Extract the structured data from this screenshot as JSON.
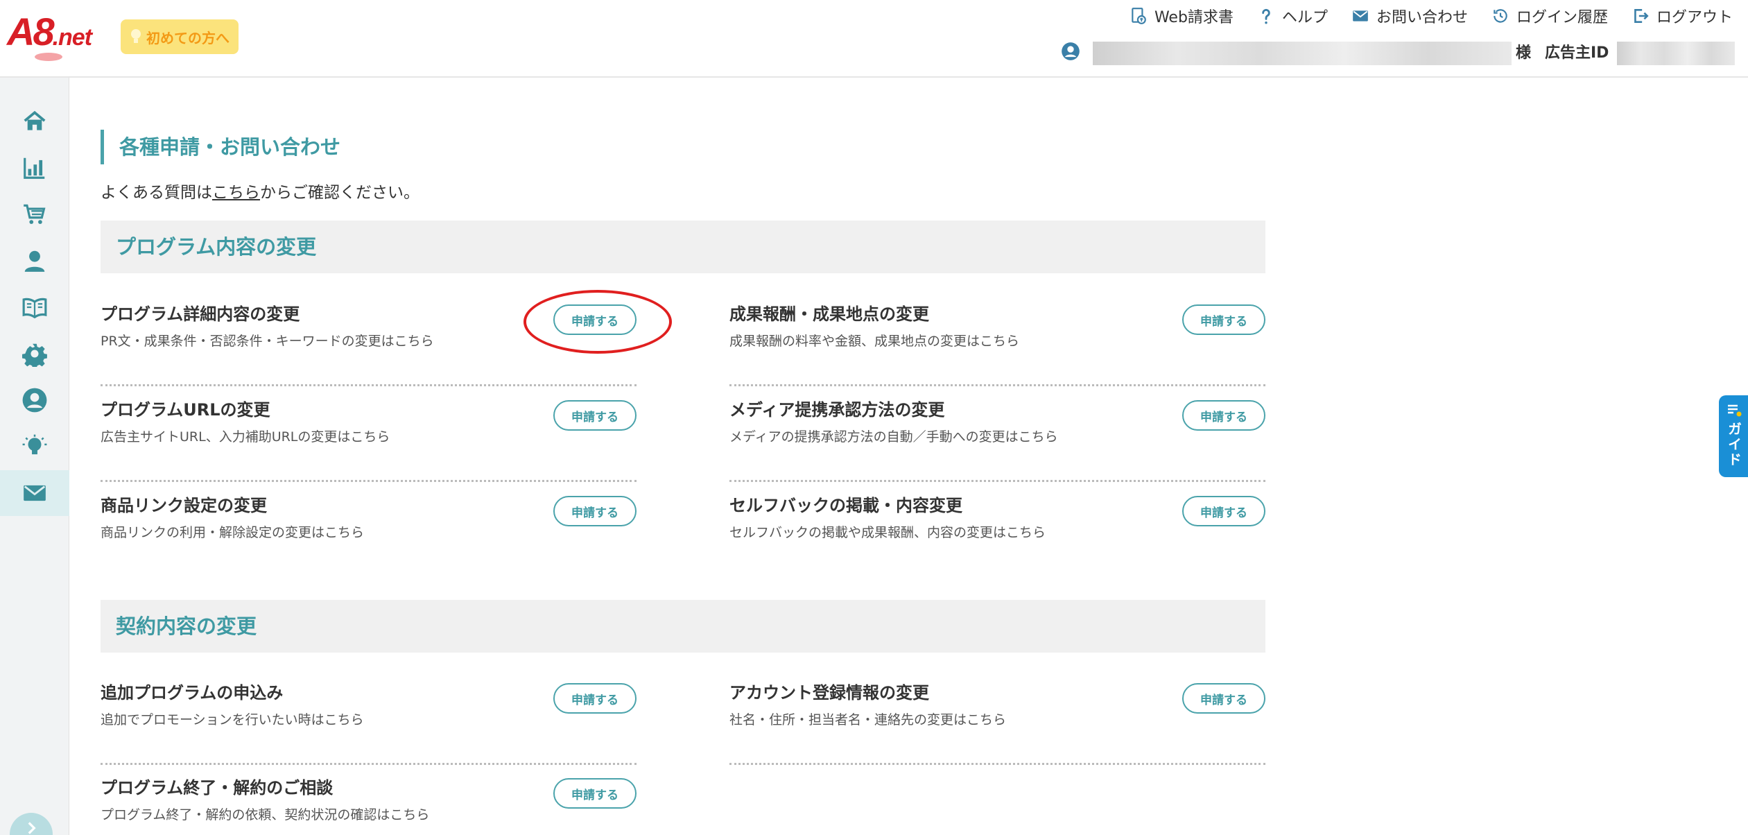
{
  "brand": {
    "logo_main": "A8",
    "logo_suffix": ".net"
  },
  "header": {
    "first_time_label": "初めての方へ",
    "links": {
      "invoice": "Web請求書",
      "help": "ヘルプ",
      "contact": "お問い合わせ",
      "login_history": "ログイン履歴",
      "logout": "ログアウト"
    },
    "account": {
      "name_suffix": "様",
      "advertiser_id_label": "広告主ID"
    }
  },
  "sidebar": {
    "items": [
      "home-icon",
      "chart-icon",
      "cart-icon",
      "person-icon",
      "book-icon",
      "gear-icon",
      "account-circle-icon",
      "lightbulb-icon",
      "mail-icon"
    ],
    "active": "mail-icon"
  },
  "page": {
    "title": "各種申請・お問い合わせ",
    "faq_prefix": "よくある質問は",
    "faq_link": "こちら",
    "faq_suffix": "からご確認ください。"
  },
  "sections": {
    "program": {
      "heading": "プログラム内容の変更",
      "items": [
        {
          "title": "プログラム詳細内容の変更",
          "desc": "PR文・成果条件・否認条件・キーワードの変更はこちら",
          "button": "申請する"
        },
        {
          "title": "成果報酬・成果地点の変更",
          "desc": "成果報酬の料率や金額、成果地点の変更はこちら",
          "button": "申請する"
        },
        {
          "title": "プログラムURLの変更",
          "desc": "広告主サイトURL、入力補助URLの変更はこちら",
          "button": "申請する"
        },
        {
          "title": "メディア提携承認方法の変更",
          "desc": "メディアの提携承認方法の自動／手動への変更はこちら",
          "button": "申請する"
        },
        {
          "title": "商品リンク設定の変更",
          "desc": "商品リンクの利用・解除設定の変更はこちら",
          "button": "申請する"
        },
        {
          "title": "セルフバックの掲載・内容変更",
          "desc": "セルフバックの掲載や成果報酬、内容の変更はこちら",
          "button": "申請する"
        }
      ]
    },
    "contract": {
      "heading": "契約内容の変更",
      "items": [
        {
          "title": "追加プログラムの申込み",
          "desc": "追加でプロモーションを行いたい時はこちら",
          "button": "申請する"
        },
        {
          "title": "アカウント登録情報の変更",
          "desc": "社名・住所・担当者名・連絡先の変更はこちら",
          "button": "申請する"
        },
        {
          "title": "プログラム終了・解約のご相談",
          "desc": "プログラム終了・解約の依頼、契約状況の確認はこちら",
          "button": "申請する"
        }
      ]
    }
  },
  "guide": {
    "label": "ガイド"
  },
  "colors": {
    "accent": "#3f9aa3",
    "logo": "#d81f26",
    "highlight": "#e01f1f",
    "guide": "#1a8fd6"
  }
}
